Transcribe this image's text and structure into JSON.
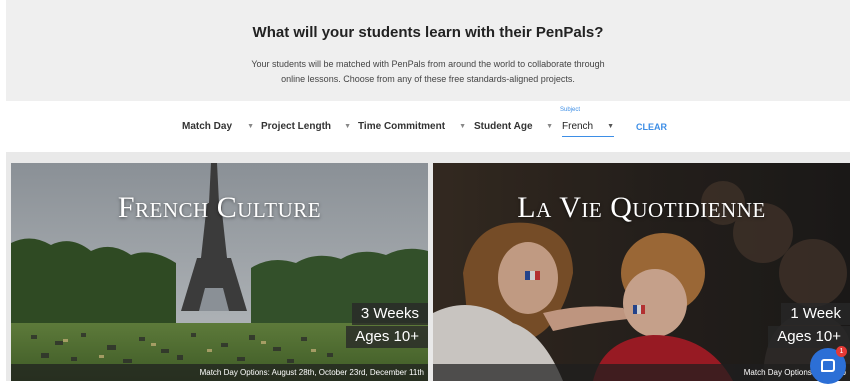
{
  "hero": {
    "title": "What will your students learn with their PenPals?",
    "subtitle_line1": "Your students will be matched with PenPals from around the world to collaborate through",
    "subtitle_line2": "online lessons. Choose from any of these free standards-aligned projects."
  },
  "filters": {
    "match_day": "Match Day",
    "project_length": "Project Length",
    "time_commitment": "Time Commitment",
    "student_age": "Student Age",
    "subject_caption": "Subject",
    "subject_value": "French",
    "clear_label": "CLEAR"
  },
  "cards": [
    {
      "title": "French Culture",
      "duration": "3 Weeks",
      "ages": "Ages 10+",
      "match_days": "Match Day Options: August 28th, October 23rd, December 11th"
    },
    {
      "title": "La Vie Quotidienne",
      "duration": "1 Week",
      "ages": "Ages 10+",
      "match_days": "Match Day Options: Decemb"
    }
  ],
  "chat": {
    "notification_count": "1"
  },
  "colors": {
    "accent_blue": "#3d8ee6",
    "chat_blue": "#2c6fd6",
    "badge_red": "#e53935"
  }
}
